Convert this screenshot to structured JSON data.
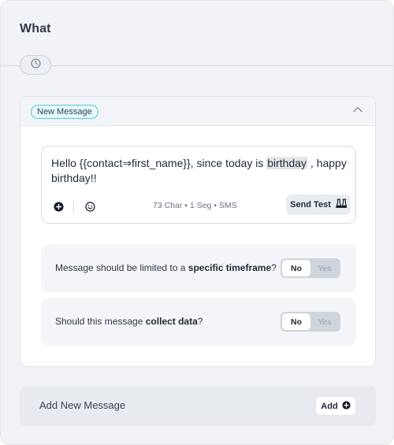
{
  "section": {
    "title": "What"
  },
  "message_card": {
    "badge": "New Message",
    "editor": {
      "text_before": "Hello {{contact⇒first_name}}, since today is ",
      "text_highlight": "birthday",
      "text_after": " , happy birthday!!",
      "meta": "73 Char • 1 Seg • SMS",
      "send_test_label": "Send Test"
    },
    "questions": [
      {
        "prefix": "Message should be limited to a ",
        "bold": "specific timeframe",
        "suffix": "?",
        "no_label": "No",
        "yes_label": "Yes",
        "selected": "No"
      },
      {
        "prefix": "Should this message ",
        "bold": "collect data",
        "suffix": "?",
        "no_label": "No",
        "yes_label": "Yes",
        "selected": "No"
      }
    ]
  },
  "add_message": {
    "label": "Add New Message",
    "button_label": "Add"
  },
  "icons": [
    "clock-icon",
    "chevron-up-icon",
    "plus-circle-icon",
    "smiley-icon",
    "flask-icon"
  ],
  "colors": {
    "badge_border": "#5cc7d6",
    "badge_bg": "#e6f8fa",
    "panel_bg": "#f3f5f8"
  }
}
